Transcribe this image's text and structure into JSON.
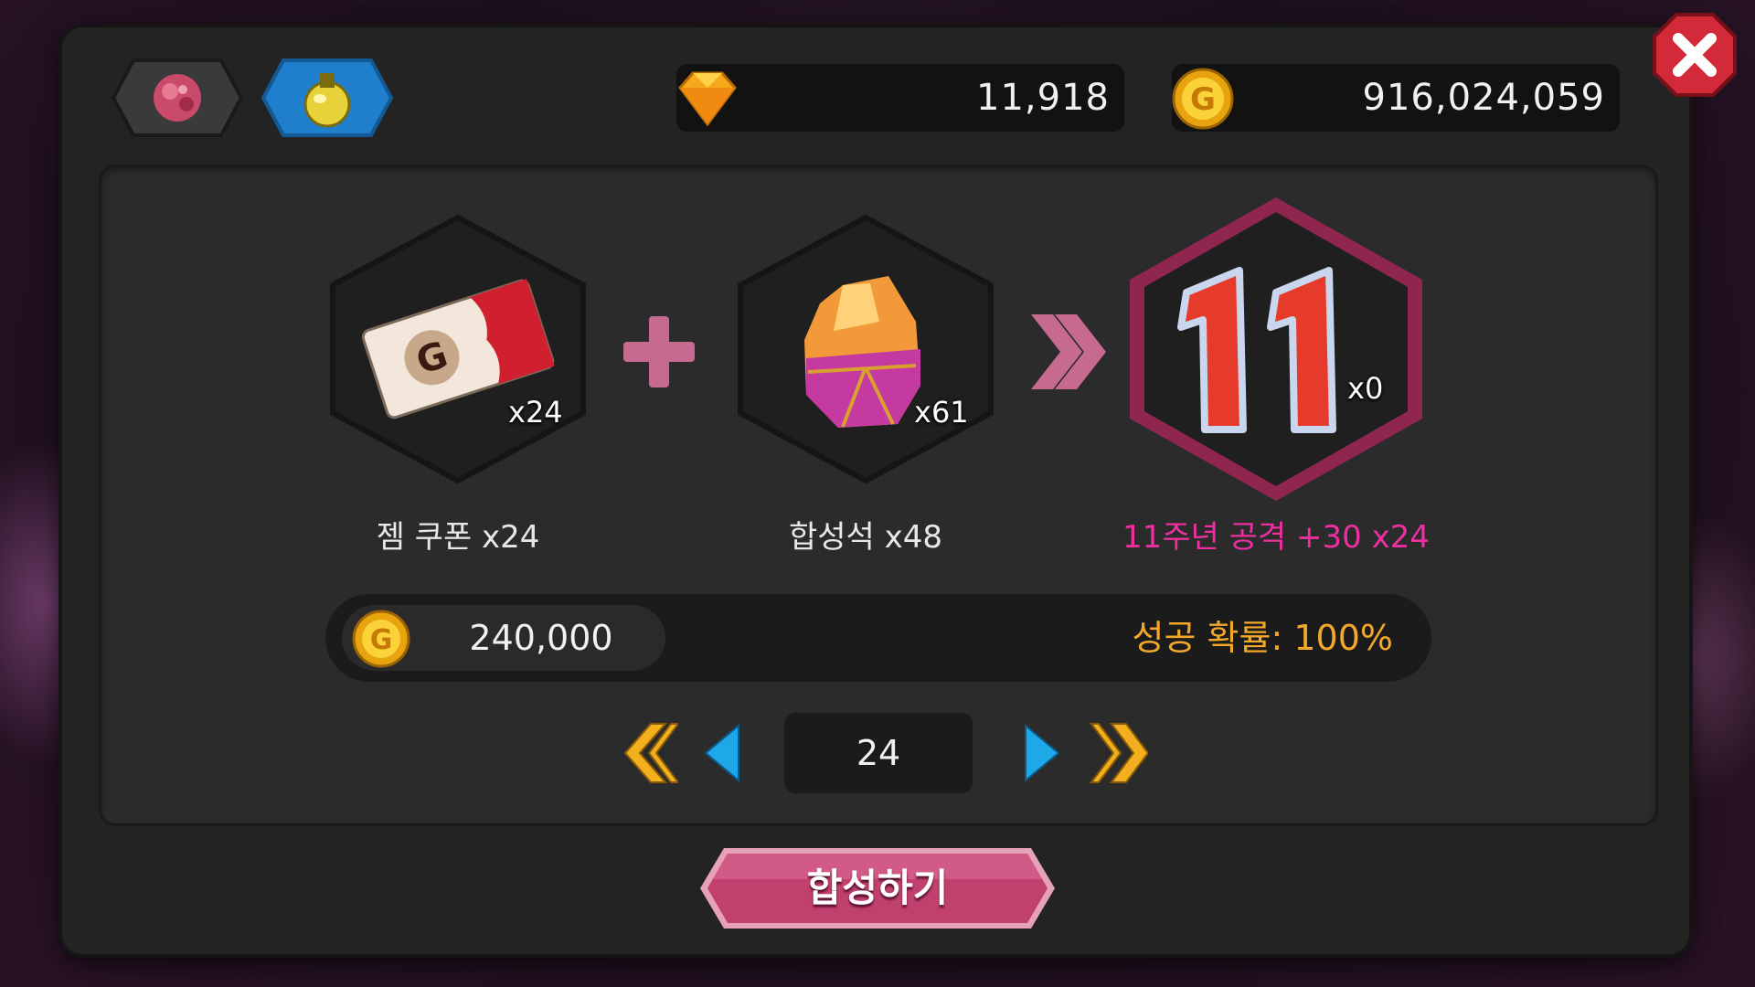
{
  "currency": {
    "gems": "11,918",
    "gold": "916,024,059"
  },
  "tabs": [
    {
      "icon": "ruby-ore-icon",
      "active": false
    },
    {
      "icon": "potion-icon",
      "active": true
    }
  ],
  "recipe": {
    "ingredient1": {
      "icon": "gem-coupon-icon",
      "owned": "x24",
      "label": "젬 쿠폰 x24"
    },
    "ingredient2": {
      "icon": "synthesis-stone-icon",
      "owned": "x61",
      "label": "합성석 x48"
    },
    "result": {
      "icon": "anniversary-11-icon",
      "owned": "x0",
      "label": "11주년 공격 +30 x24"
    }
  },
  "cost": {
    "gold": "240,000",
    "success_rate": "성공 확률: 100%"
  },
  "quantity": "24",
  "buttons": {
    "synthesize": "합성하기"
  },
  "colors": {
    "result_label": "#ee2f9f",
    "rate_text": "#f3a82a",
    "synth_button": "#c0406e",
    "nav_blue": "#1fa8e8",
    "nav_gold": "#f2b01e"
  }
}
